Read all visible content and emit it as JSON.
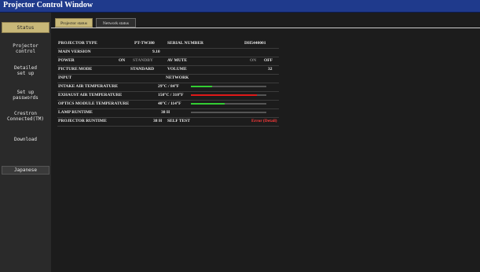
{
  "window": {
    "title": "Projector Control Window"
  },
  "sidebar": {
    "items": [
      {
        "label": "Status"
      },
      {
        "label": "Projector\ncontrol"
      },
      {
        "label": "Detailed\nset up"
      },
      {
        "label": "Set up\npasswords"
      },
      {
        "label": "Crestron\nConnected(TM)"
      },
      {
        "label": "Download"
      }
    ],
    "language_button": "Japanese"
  },
  "tabs": [
    {
      "label": "Projector status"
    },
    {
      "label": "Network status"
    }
  ],
  "status": {
    "projector_type_label": "PROJECTOR TYPE",
    "projector_type_value": "PT-TW380",
    "serial_number_label": "SERIAL NUMBER",
    "serial_number_value": "DH5440001",
    "main_version_label": "MAIN VERSION",
    "main_version_value": "9.10",
    "power_label": "POWER",
    "power_on": "ON",
    "power_standby": "STANDBY",
    "av_mute_label": "AV MUTE",
    "av_mute_on": "ON",
    "av_mute_off": "OFF",
    "picture_mode_label": "PICTURE MODE",
    "picture_mode_value": "STANDARD",
    "volume_label": "VOLUME",
    "volume_value": "32",
    "input_label": "INPUT",
    "network_label": "NETWORK",
    "intake_label": "INTAKE AIR TEMPERATURE",
    "intake_value": "29°C / 84°F",
    "intake_level": 0.28,
    "exhaust_label": "EXHAUST AIR TEMPERATURE",
    "exhaust_value": "150°C / 310°F",
    "exhaust_level": 0.88,
    "optics_label": "OPTICS MODULE TEMPERATURE",
    "optics_value": "40°C / 114°F",
    "optics_level": 0.45,
    "lamp_runtime_label": "LAMP RUNTIME",
    "lamp_runtime_value": "38 H",
    "projector_runtime_label": "PROJECTOR RUNTIME",
    "projector_runtime_value": "38 H",
    "self_test_label": "SELF TEST",
    "self_test_value": "Error (Detail)"
  },
  "colors": {
    "title_bar": "#1f3a8c",
    "active_tab": "#c8b878",
    "bar_normal": "#33cc33",
    "bar_warning": "#e01919",
    "error_text": "#ff3a3a"
  }
}
